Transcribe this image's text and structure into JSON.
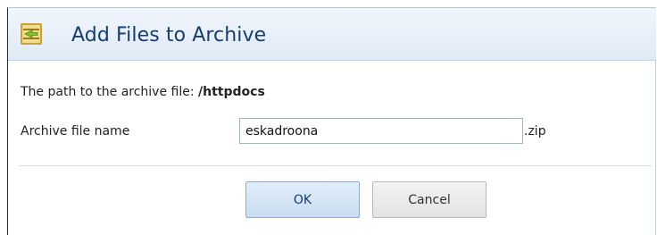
{
  "dialog": {
    "title": "Add Files to Archive",
    "icon": "archive-add-icon"
  },
  "path": {
    "label": "The path to the archive file:",
    "value": "/httpdocs"
  },
  "archive_name": {
    "label": "Archive file name",
    "value": "eskadroona",
    "extension": ".zip"
  },
  "buttons": {
    "ok": "OK",
    "cancel": "Cancel"
  },
  "colors": {
    "header_bg": "#e6eff9",
    "title": "#163d6e",
    "icon_accent": "#7fbf2a"
  }
}
